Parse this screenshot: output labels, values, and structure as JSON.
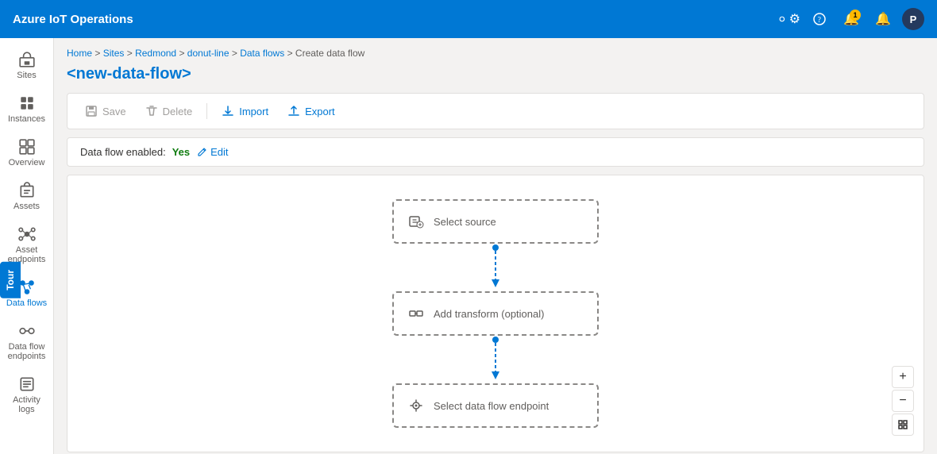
{
  "topbar": {
    "title": "Azure IoT Operations",
    "icons": {
      "settings": "⚙",
      "help": "?",
      "notifications_badge": "1",
      "bell": "🔔",
      "avatar": "P"
    }
  },
  "sidebar": {
    "items": [
      {
        "id": "sites",
        "label": "Sites",
        "active": false
      },
      {
        "id": "instances",
        "label": "Instances",
        "active": false
      },
      {
        "id": "overview",
        "label": "Overview",
        "active": false
      },
      {
        "id": "assets",
        "label": "Assets",
        "active": false
      },
      {
        "id": "asset-endpoints",
        "label": "Asset endpoints",
        "active": false
      },
      {
        "id": "data-flows",
        "label": "Data flows",
        "active": true
      },
      {
        "id": "data-flow-endpoints",
        "label": "Data flow endpoints",
        "active": false
      },
      {
        "id": "activity-logs",
        "label": "Activity logs",
        "active": false
      }
    ]
  },
  "tour": {
    "label": "Tour"
  },
  "breadcrumb": {
    "parts": [
      "Home",
      "Sites",
      "Redmond",
      "donut-line",
      "Data flows",
      "Create data flow"
    ],
    "separators": [
      ">",
      ">",
      ">",
      ">",
      ">"
    ]
  },
  "page": {
    "title": "<new-data-flow>"
  },
  "toolbar": {
    "save": "Save",
    "delete": "Delete",
    "import": "Import",
    "export": "Export"
  },
  "dataflow": {
    "enabled_label": "Data flow enabled:",
    "enabled_value": "Yes",
    "edit_label": "Edit"
  },
  "flow_nodes": {
    "source": {
      "label": "Select source"
    },
    "transform": {
      "label": "Add transform (optional)"
    },
    "endpoint": {
      "label": "Select data flow endpoint"
    }
  },
  "zoom": {
    "plus": "+",
    "minus": "−",
    "reset": "⊡"
  }
}
